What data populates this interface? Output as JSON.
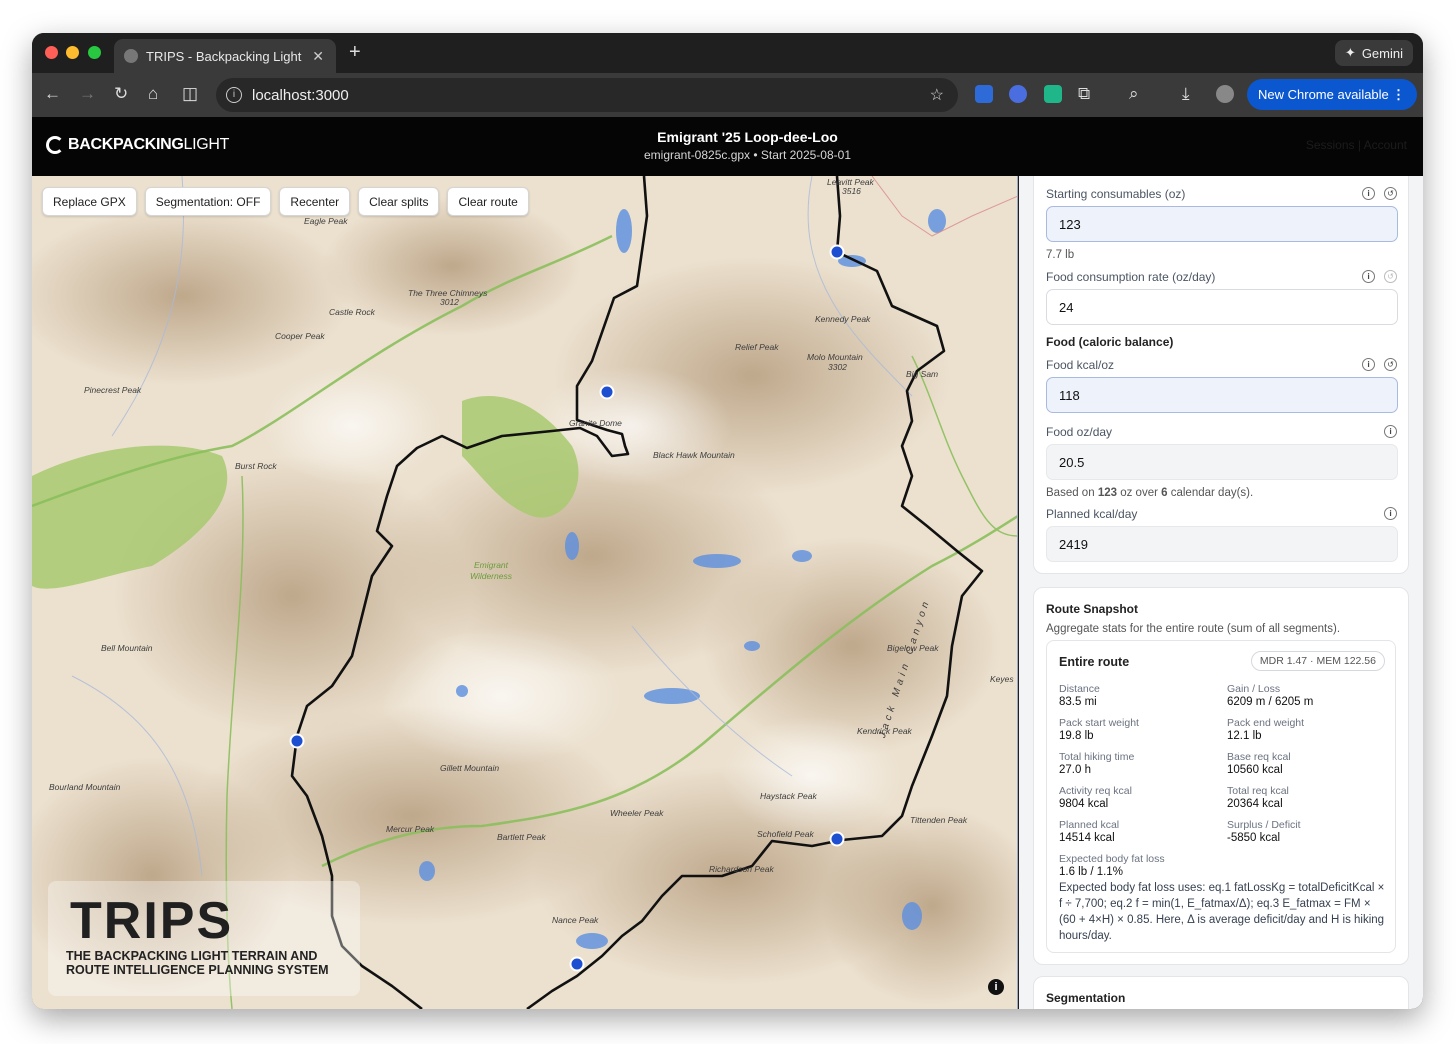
{
  "browser": {
    "tab_title": "TRIPS - Backpacking Light",
    "gemini_label": "Gemini",
    "url": "localhost:3000",
    "new_chrome_label": "New Chrome available"
  },
  "app": {
    "brand_bold": "BACKPACKING",
    "brand_light": "LIGHT",
    "title": "Emigrant '25 Loop-dee-Loo",
    "subtitle": "emigrant-0825c.gpx • Start 2025-08-01",
    "nav": "Sessions | Account"
  },
  "map": {
    "buttons": [
      "Replace GPX",
      "Segmentation: OFF",
      "Recenter",
      "Clear splits",
      "Clear route"
    ],
    "peaks": [
      {
        "name": "Leavitt Peak"
      },
      {
        "name": "3516"
      },
      {
        "name": "Eagle Peak"
      },
      {
        "name": "The Three Chimneys"
      },
      {
        "name": "3012"
      },
      {
        "name": "Castle Rock"
      },
      {
        "name": "Cooper Peak"
      },
      {
        "name": "Kennedy Peak"
      },
      {
        "name": "Relief Peak"
      },
      {
        "name": "Molo Mountain"
      },
      {
        "name": "3302"
      },
      {
        "name": "Big Sam"
      },
      {
        "name": "Pinecrest Peak"
      },
      {
        "name": "Granite Dome"
      },
      {
        "name": "Black Hawk Mountain"
      },
      {
        "name": "Burst Rock"
      },
      {
        "name": "Emigrant"
      },
      {
        "name": "Wilderness"
      },
      {
        "name": "Bell Mountain"
      },
      {
        "name": "Bigelow Peak"
      },
      {
        "name": "Keyes"
      },
      {
        "name": "Kendrick Peak"
      },
      {
        "name": "Jack Main Canyon"
      },
      {
        "name": "Gillett Mountain"
      },
      {
        "name": "Bourland Mountain"
      },
      {
        "name": "Haystack Peak"
      },
      {
        "name": "Wheeler Peak"
      },
      {
        "name": "Mercur Peak"
      },
      {
        "name": "Bartlett Peak"
      },
      {
        "name": "Schofield Peak"
      },
      {
        "name": "Tittenden Peak"
      },
      {
        "name": "Richardson Peak"
      },
      {
        "name": "Nance Peak"
      }
    ],
    "logo_word": "TRIPS",
    "logo_tagline_1": "THE BACKPACKING LIGHT TERRAIN AND",
    "logo_tagline_2": "ROUTE INTELLIGENCE PLANNING SYSTEM",
    "route_color": "#111111",
    "trail_color": "#7dbb4d",
    "marker_color": "#1f4fd1"
  },
  "consumables": {
    "starting_label": "Starting consumables (oz)",
    "starting_value": "123",
    "starting_hint": "7.7 lb",
    "rate_label": "Food consumption rate (oz/day)",
    "rate_value": "24",
    "caloric_heading": "Food (caloric balance)",
    "kcal_oz_label": "Food kcal/oz",
    "kcal_oz_value": "118",
    "oz_day_label": "Food oz/day",
    "oz_day_value": "20.5",
    "based_prefix": "Based on",
    "based_oz": "123",
    "based_mid": "oz over",
    "based_days": "6",
    "based_suffix": "calendar day(s).",
    "planned_label": "Planned kcal/day",
    "planned_value": "2419"
  },
  "snapshot": {
    "heading": "Route Snapshot",
    "description": "Aggregate stats for the entire route (sum of all segments).",
    "entire_route": "Entire route",
    "badge": "MDR 1.47 · MEM 122.56",
    "stats": [
      {
        "label": "Distance",
        "value": "83.5 mi"
      },
      {
        "label": "Gain / Loss",
        "value": "6209 m / 6205 m"
      },
      {
        "label": "Pack start weight",
        "value": "19.8 lb"
      },
      {
        "label": "Pack end weight",
        "value": "12.1 lb"
      },
      {
        "label": "Total hiking time",
        "value": "27.0 h"
      },
      {
        "label": "Base req kcal",
        "value": "10560 kcal"
      },
      {
        "label": "Activity req kcal",
        "value": "9804 kcal"
      },
      {
        "label": "Total req kcal",
        "value": "20364 kcal"
      },
      {
        "label": "Planned kcal",
        "value": "14514 kcal"
      },
      {
        "label": "Surplus / Deficit",
        "value": "-5850 kcal"
      },
      {
        "label": "Expected body fat loss",
        "value": "1.6 lb / 1.1%"
      }
    ],
    "note": "Expected body fat loss uses: eq.1 fatLossKg = totalDeficitKcal × f ÷ 7,700; eq.2 f = min(1, E_fatmax/Δ); eq.3 E_fatmax = FM × (60 + 4×H) × 0.85. Here, Δ is average deficit/day and H is hiking hours/day."
  },
  "segmentation": {
    "heading": "Segmentation"
  }
}
